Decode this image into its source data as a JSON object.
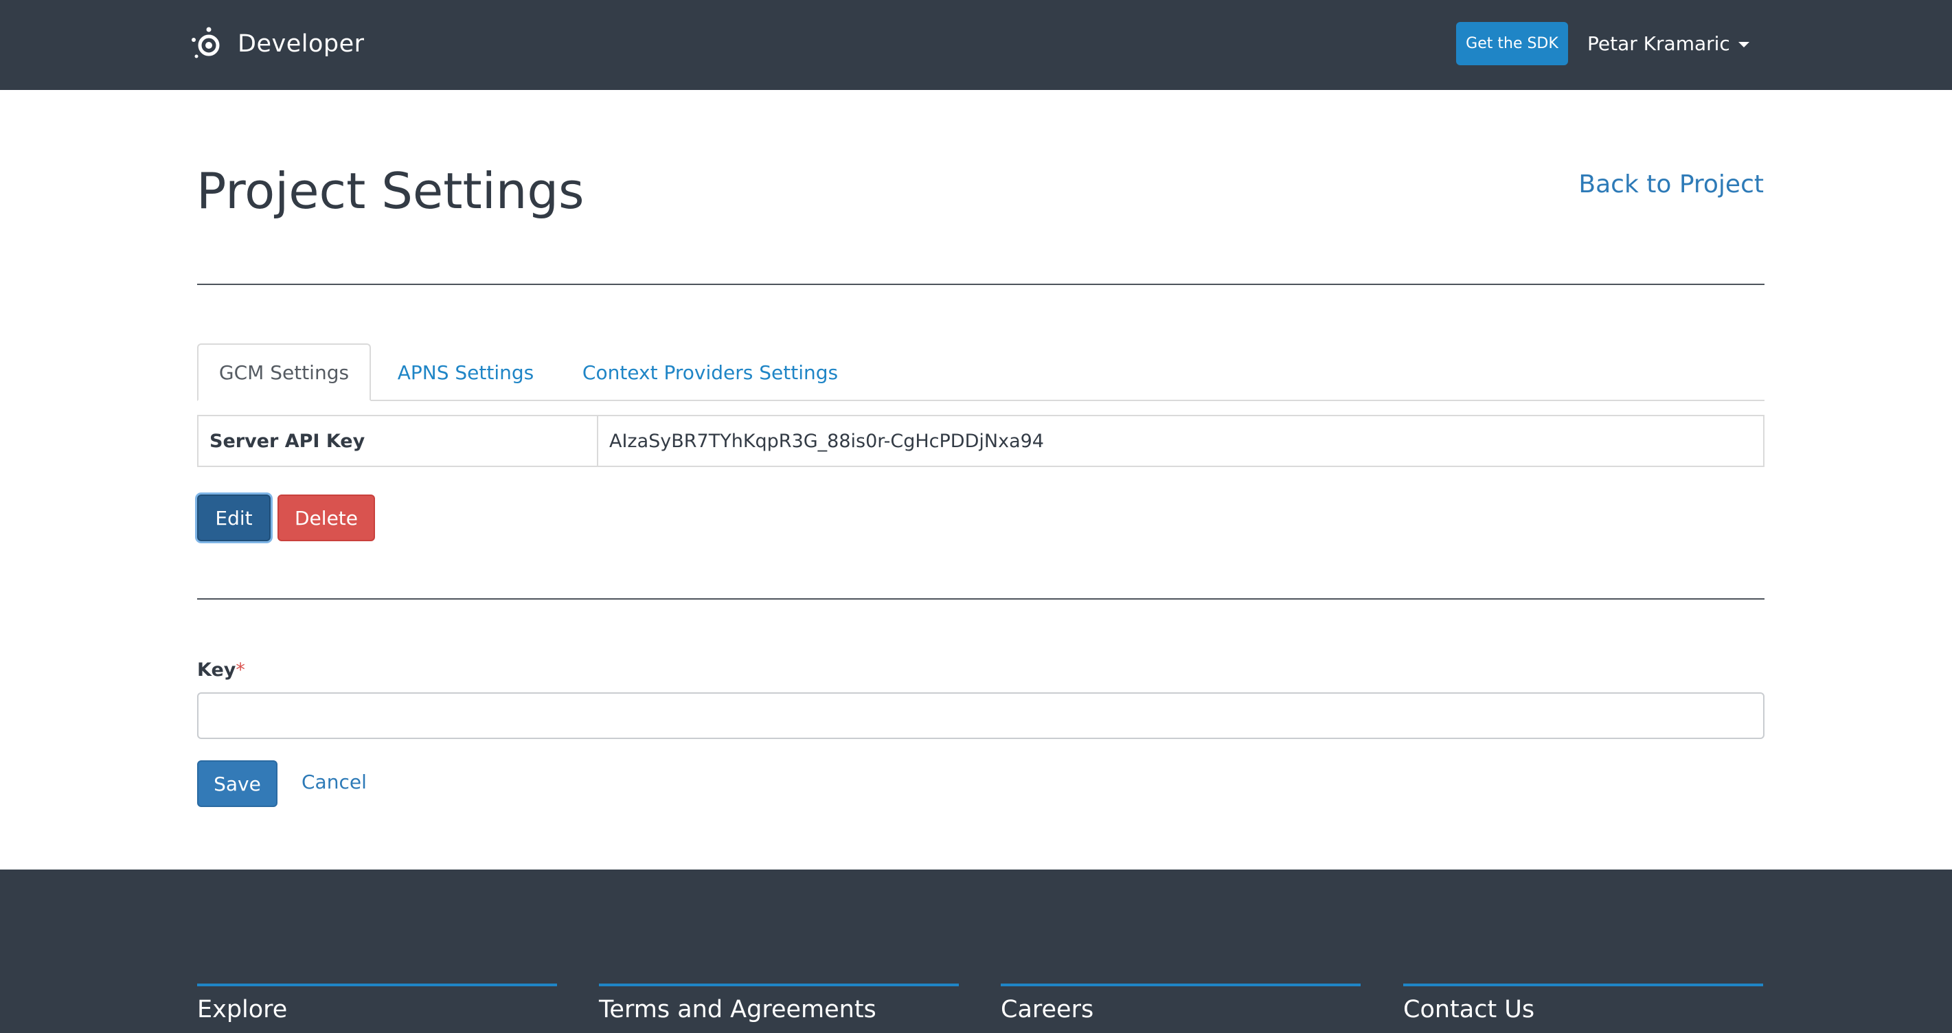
{
  "navbar": {
    "brand_text": "Developer",
    "sdk_button_label": "Get the SDK",
    "user_name": "Petar Kramaric"
  },
  "page": {
    "title": "Project Settings",
    "back_link": "Back to Project"
  },
  "tabs": [
    {
      "label": "GCM Settings",
      "active": true
    },
    {
      "label": "APNS Settings",
      "active": false
    },
    {
      "label": "Context Providers Settings",
      "active": false
    }
  ],
  "key_table": {
    "label": "Server API Key",
    "value": "AIzaSyBR7TYhKqpR3G_88is0r-CgHcPDDjNxa94"
  },
  "actions": {
    "edit_label": "Edit",
    "delete_label": "Delete"
  },
  "form": {
    "key_label": "Key",
    "required_marker": "*",
    "key_value": "",
    "save_label": "Save",
    "cancel_label": "Cancel"
  },
  "footer": {
    "columns": [
      "Explore",
      "Terms and Agreements",
      "Careers",
      "Contact Us"
    ]
  },
  "colors": {
    "navbar_bg": "#343d48",
    "accent": "#1f85c6",
    "link": "#2d7ab7",
    "danger": "#d9534f",
    "primary_dark": "#285f91"
  },
  "icons": {
    "brand": "developer-logo-icon",
    "user_caret": "caret-down-icon"
  }
}
